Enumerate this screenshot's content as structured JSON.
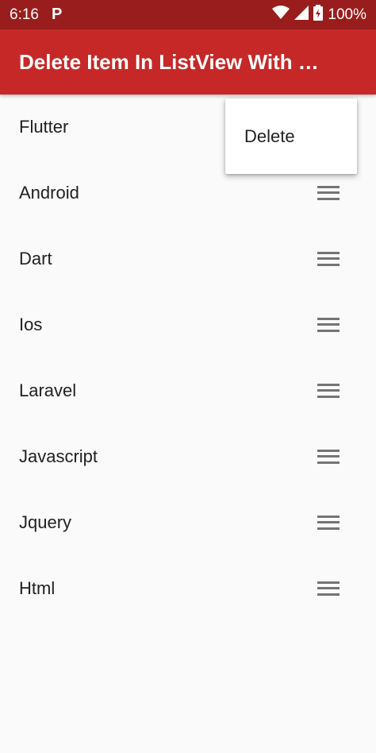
{
  "status_bar": {
    "time": "6:16",
    "notification_icon": "p-app-icon",
    "battery": "100%",
    "icons": [
      "wifi-icon",
      "signal-icon",
      "battery-charging-icon"
    ]
  },
  "app_bar": {
    "title": "Delete Item In ListView With …",
    "color": "#c62828",
    "status_color": "#9a1d1d"
  },
  "list": {
    "items": [
      {
        "label": "Flutter"
      },
      {
        "label": "Android"
      },
      {
        "label": "Dart"
      },
      {
        "label": "Ios"
      },
      {
        "label": "Laravel"
      },
      {
        "label": "Javascript"
      },
      {
        "label": "Jquery"
      },
      {
        "label": "Html"
      }
    ],
    "handle_icon": "drag-handle-icon"
  },
  "popup_menu": {
    "items": [
      {
        "label": "Delete"
      }
    ]
  }
}
